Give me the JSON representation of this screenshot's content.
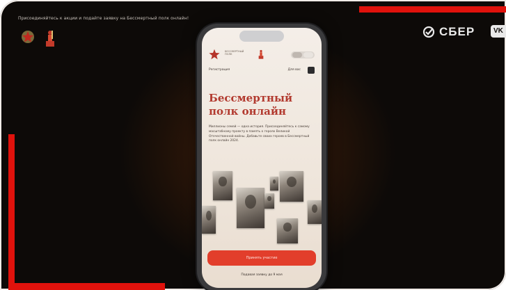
{
  "caption": "Присоединяйтесь к акции и подайте заявку на Бессмертный полк онлайн!",
  "sber_label": "СБЕР",
  "vk_label": "VK",
  "app": {
    "logo_label": "БЕССМЕРТНЫЙ ПОЛК",
    "nav_left": "Регистрация",
    "nav_right": "Для вас",
    "title": "Бессмертный полк онлайн",
    "body": "Миллионы семей — одна история. Присоединяйтесь к самому масштабному проекту в память о героях Великой Отечественной войны. Добавьте своих героев в Бессмертный полк онлайн 2024.",
    "cta_label": "Принять участие",
    "sub_link": "Подавая заявку до 9 мая"
  },
  "colors": {
    "accent_red": "#e0120c",
    "title_red": "#b23a2f",
    "cta_red": "#e23e2b",
    "background": "#0d0a08"
  }
}
